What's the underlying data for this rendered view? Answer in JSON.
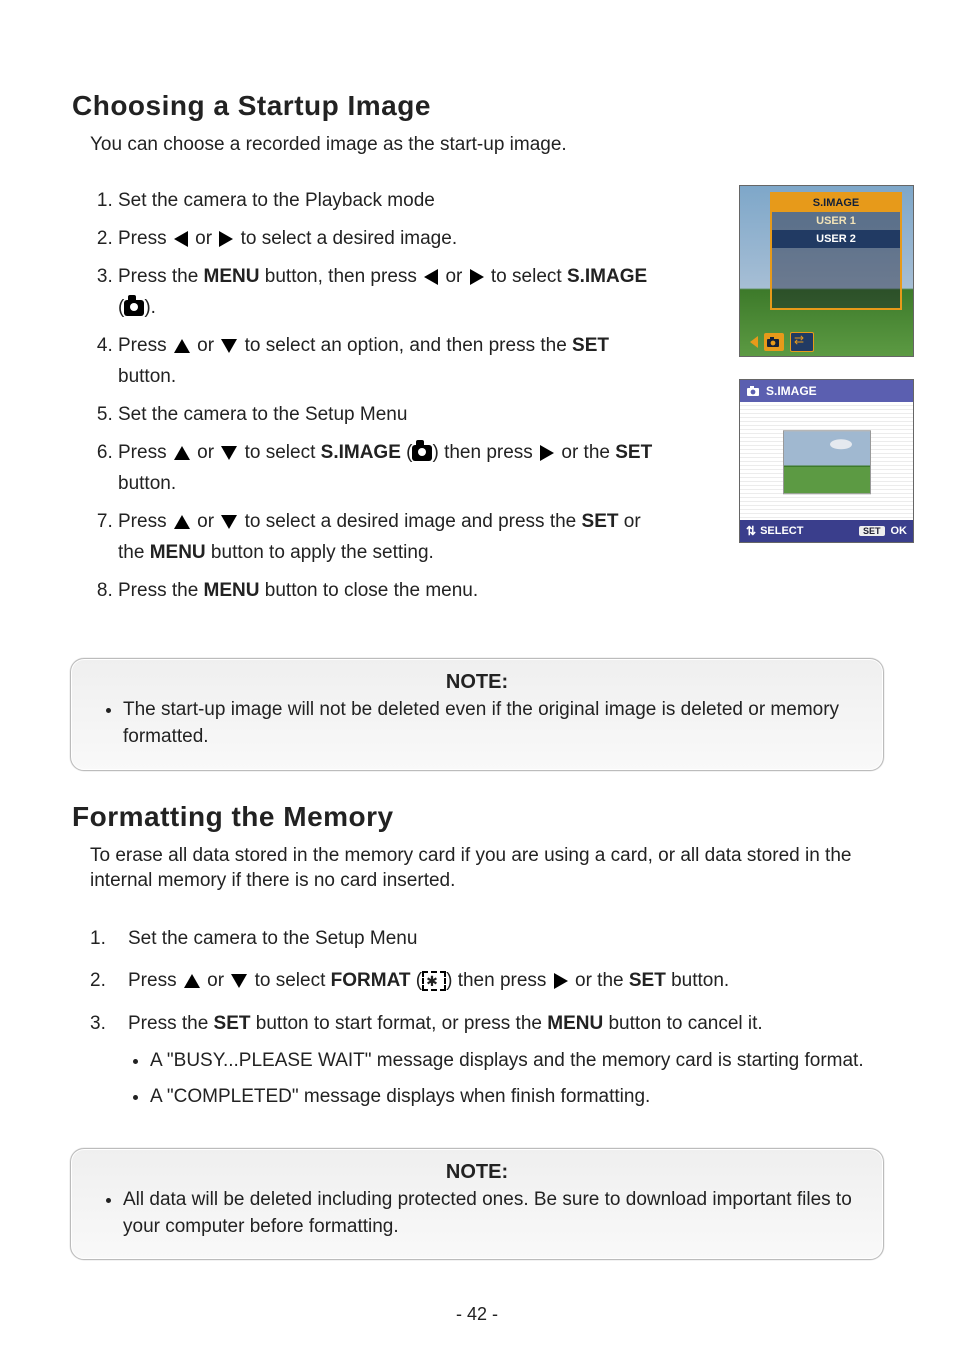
{
  "page_number": "- 42 -",
  "section1": {
    "title": "Choosing a Startup Image",
    "intro": "You can choose a recorded image as the start-up image.",
    "steps": [
      {
        "parts": [
          {
            "t": "Set the camera to the Playback mode"
          }
        ]
      },
      {
        "parts": [
          {
            "t": "Press "
          },
          {
            "icon": "left"
          },
          {
            "t": " or "
          },
          {
            "icon": "right"
          },
          {
            "t": " to select a desired image."
          }
        ]
      },
      {
        "parts": [
          {
            "t": "Press the "
          },
          {
            "b": "MENU"
          },
          {
            "t": " button, then press "
          },
          {
            "icon": "left"
          },
          {
            "t": " or "
          },
          {
            "icon": "right"
          },
          {
            "t": " to select "
          },
          {
            "b": "S.IMAGE"
          },
          {
            "t": " ("
          },
          {
            "icon": "camera"
          },
          {
            "t": ")."
          }
        ]
      },
      {
        "parts": [
          {
            "t": "Press "
          },
          {
            "icon": "up"
          },
          {
            "t": " or "
          },
          {
            "icon": "down"
          },
          {
            "t": " to select an option, and then press the "
          },
          {
            "b": "SET"
          },
          {
            "t": " button."
          }
        ]
      },
      {
        "parts": [
          {
            "t": "Set the camera to the Setup Menu"
          }
        ]
      },
      {
        "parts": [
          {
            "t": "Press "
          },
          {
            "icon": "up"
          },
          {
            "t": " or "
          },
          {
            "icon": "down"
          },
          {
            "t": " to select "
          },
          {
            "b": "S.IMAGE"
          },
          {
            "t": " ("
          },
          {
            "icon": "camera"
          },
          {
            "t": ") then press "
          },
          {
            "icon": "right"
          },
          {
            "t": " or the "
          },
          {
            "b": "SET"
          },
          {
            "t": " button."
          }
        ]
      },
      {
        "parts": [
          {
            "t": "Press "
          },
          {
            "icon": "up"
          },
          {
            "t": " or "
          },
          {
            "icon": "down"
          },
          {
            "t": " to select a desired image and press the "
          },
          {
            "b": "SET"
          },
          {
            "t": " or the "
          },
          {
            "b": "MENU"
          },
          {
            "t": " button to apply the setting."
          }
        ]
      },
      {
        "parts": [
          {
            "t": "Press the "
          },
          {
            "b": "MENU"
          },
          {
            "t": " button to close the menu."
          }
        ]
      }
    ]
  },
  "note1": {
    "title": "NOTE:",
    "items": [
      "The start-up image will not be deleted even if the original image is deleted or memory formatted."
    ]
  },
  "section2": {
    "title": "Formatting the Memory",
    "intro": "To erase all data stored in the memory card if you are using a card, or all data stored in the internal memory if there is no card inserted.",
    "steps": [
      {
        "parts": [
          {
            "t": "Set the camera to the Setup Menu"
          }
        ]
      },
      {
        "parts": [
          {
            "t": "Press "
          },
          {
            "icon": "up"
          },
          {
            "t": " or "
          },
          {
            "icon": "down"
          },
          {
            "t": " to select "
          },
          {
            "b": "FORMAT"
          },
          {
            "t": " ("
          },
          {
            "icon": "format"
          },
          {
            "t": ") then press "
          },
          {
            "icon": "right"
          },
          {
            "t": " or the "
          },
          {
            "b": "SET"
          },
          {
            "t": " button."
          }
        ]
      },
      {
        "parts": [
          {
            "t": "Press the "
          },
          {
            "b": "SET"
          },
          {
            "t": " button to start format, or press the "
          },
          {
            "b": "MENU"
          },
          {
            "t": " button to cancel it."
          }
        ],
        "bullets": [
          "A \"BUSY...PLEASE WAIT\" message displays and the memory card is starting format.",
          "A \"COMPLETED\" message displays when finish formatting."
        ]
      }
    ]
  },
  "note2": {
    "title": "NOTE:",
    "items": [
      "All data will be deleted including protected ones. Be sure to download important files to your computer before formatting."
    ]
  },
  "screen1": {
    "menu_title": "S.IMAGE",
    "option1": "USER 1",
    "option2": "USER 2"
  },
  "screen2": {
    "header": "S.IMAGE",
    "footer_select": "SELECT",
    "footer_set": "SET",
    "footer_ok": "OK"
  }
}
